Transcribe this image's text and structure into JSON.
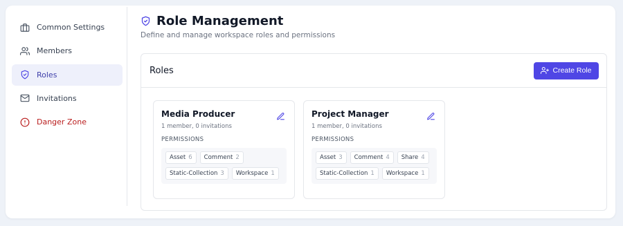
{
  "sidebar": {
    "items": [
      {
        "label": "Common Settings",
        "icon": "briefcase-icon"
      },
      {
        "label": "Members",
        "icon": "users-icon"
      },
      {
        "label": "Roles",
        "icon": "shield-icon",
        "active": true
      },
      {
        "label": "Invitations",
        "icon": "mail-icon"
      },
      {
        "label": "Danger Zone",
        "icon": "alert-circle-icon",
        "color": "#b91c1c"
      }
    ]
  },
  "header": {
    "title": "Role Management",
    "subtitle": "Define and manage workspace roles and permissions"
  },
  "panel": {
    "title": "Roles",
    "create_label": "Create Role"
  },
  "roles": [
    {
      "name": "Media Producer",
      "meta": "1 member, 0 invitations",
      "perm_label": "PERMISSIONS",
      "permissions": [
        {
          "name": "Asset",
          "count": "6"
        },
        {
          "name": "Comment",
          "count": "2"
        },
        {
          "name": "Static-Collection",
          "count": "3"
        },
        {
          "name": "Workspace",
          "count": "1"
        }
      ]
    },
    {
      "name": "Project Manager",
      "meta": "1 member, 0 invitations",
      "perm_label": "PERMISSIONS",
      "permissions": [
        {
          "name": "Asset",
          "count": "3"
        },
        {
          "name": "Comment",
          "count": "4"
        },
        {
          "name": "Share",
          "count": "4"
        },
        {
          "name": "Static-Collection",
          "count": "1"
        },
        {
          "name": "Workspace",
          "count": "1"
        }
      ]
    }
  ],
  "colors": {
    "accent": "#4f46e5",
    "active_bg": "#eef0fb",
    "danger": "#b91c1c"
  }
}
